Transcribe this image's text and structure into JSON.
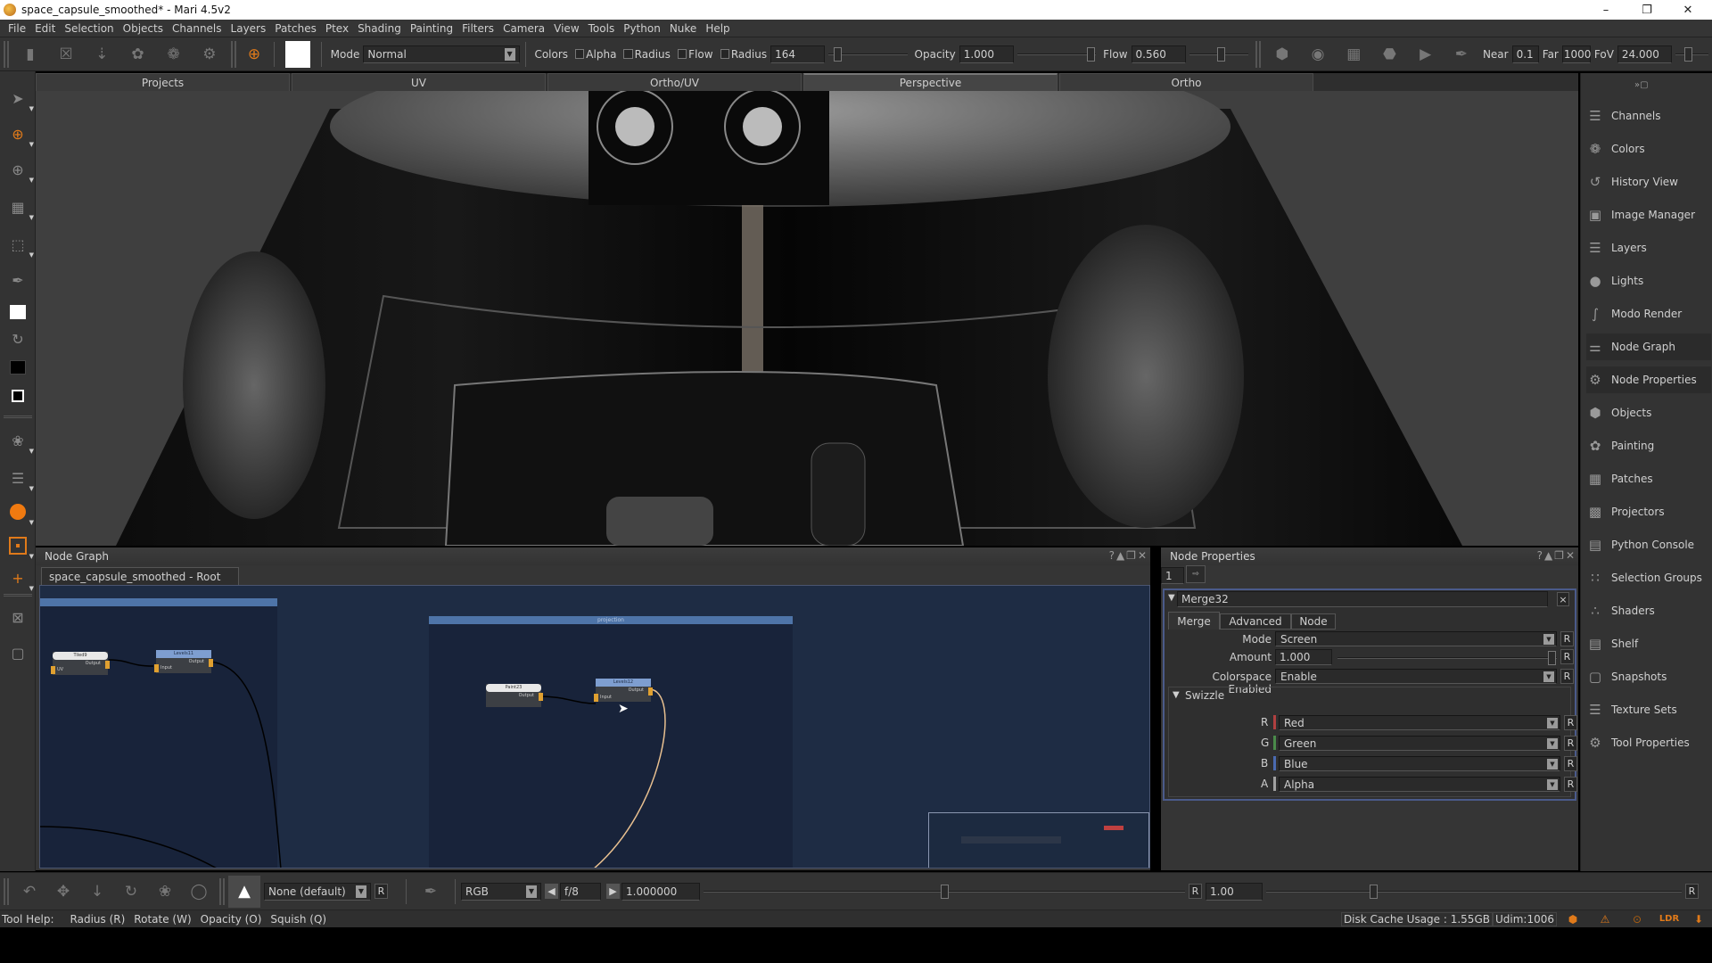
{
  "window": {
    "title": "space_capsule_smoothed* - Mari 4.5v2",
    "controls": [
      "minimize",
      "restore",
      "close"
    ]
  },
  "menubar": {
    "items": [
      "File",
      "Edit",
      "Selection",
      "Objects",
      "Channels",
      "Layers",
      "Patches",
      "Ptex",
      "Shading",
      "Painting",
      "Filters",
      "Camera",
      "View",
      "Tools",
      "Python",
      "Nuke",
      "Help"
    ]
  },
  "toolbar": {
    "mode_label": "Mode",
    "mode_value": "Normal",
    "colors_label": "Colors",
    "alpha_label": "Alpha",
    "radius_chk_label": "Radius",
    "flow_chk_label": "Flow",
    "radius_label": "Radius",
    "radius_value": "164",
    "opacity_label": "Opacity",
    "opacity_value": "1.000",
    "opacity_fraction": 1.0,
    "flow_label": "Flow",
    "flow_value": "0.560",
    "flow_fraction": 0.56,
    "near_label": "Near",
    "near_value": "0.1",
    "far_label": "Far",
    "far_value": "1000",
    "fov_label": "FoV",
    "fov_value": "24.000",
    "icons": [
      "new-file-icon",
      "close-file-icon",
      "import-file-icon",
      "bake-icon",
      "bake-merge-icon",
      "file-settings-icon",
      "paint-through-icon",
      "color-swatch-white",
      "wireframe-cube-icon",
      "camera-snapshot-icon",
      "grid-select-icon",
      "flat-shade-icon",
      "screen-icon",
      "paint-brush-icon"
    ]
  },
  "view_tabs": [
    {
      "label": "Projects",
      "active": false
    },
    {
      "label": "UV",
      "active": false
    },
    {
      "label": "Ortho/UV",
      "active": false
    },
    {
      "label": "Perspective",
      "active": true
    },
    {
      "label": "Ortho",
      "active": false
    }
  ],
  "left_tools": [
    "select-icon",
    "paint-icon",
    "paint-through-icon",
    "patch-select-icon",
    "marquee-select-icon",
    "eyedropper-icon",
    "foreground-color-white",
    "swap-colors-icon",
    "background-color-black",
    "default-colors-icon",
    "transform-select-icon",
    "layer-visibility-icon",
    "orange-circle-icon",
    "projector-icon",
    "add-projector-icon",
    "hide-selection-icon",
    "isolate-icon"
  ],
  "right_panel": {
    "items": [
      {
        "label": "Channels",
        "icon": "channels-icon"
      },
      {
        "label": "Colors",
        "icon": "colors-icon"
      },
      {
        "label": "History View",
        "icon": "history-icon"
      },
      {
        "label": "Image Manager",
        "icon": "image-manager-icon"
      },
      {
        "label": "Layers",
        "icon": "layers-icon"
      },
      {
        "label": "Lights",
        "icon": "lights-icon"
      },
      {
        "label": "Modo Render",
        "icon": "modo-render-icon"
      },
      {
        "label": "Node Graph",
        "icon": "node-graph-icon",
        "selected": true
      },
      {
        "label": "Node Properties",
        "icon": "node-properties-icon",
        "selected": true
      },
      {
        "label": "Objects",
        "icon": "objects-icon"
      },
      {
        "label": "Painting",
        "icon": "painting-icon"
      },
      {
        "label": "Patches",
        "icon": "patches-icon"
      },
      {
        "label": "Projectors",
        "icon": "projectors-icon"
      },
      {
        "label": "Python Console",
        "icon": "python-console-icon"
      },
      {
        "label": "Selection Groups",
        "icon": "selection-groups-icon"
      },
      {
        "label": "Shaders",
        "icon": "shaders-icon"
      },
      {
        "label": "Shelf",
        "icon": "shelf-icon"
      },
      {
        "label": "Snapshots",
        "icon": "snapshots-icon"
      },
      {
        "label": "Texture Sets",
        "icon": "texture-sets-icon"
      },
      {
        "label": "Tool Properties",
        "icon": "tool-properties-icon"
      }
    ]
  },
  "node_graph": {
    "title": "Node Graph",
    "tab": "space_capsule_smoothed - Root",
    "backdrops": [
      {
        "label": ""
      },
      {
        "label": "projection"
      }
    ],
    "nodes": [
      {
        "name": "Tiled9",
        "header": "white",
        "ports_in": [
          "UV"
        ],
        "ports_out": [
          "Output"
        ]
      },
      {
        "name": "Levels11",
        "header": "blue",
        "ports_in": [
          "Input"
        ],
        "ports_out": [
          "Output"
        ]
      },
      {
        "name": "Paint23",
        "header": "white",
        "ports_in": [],
        "ports_out": [
          "Output"
        ]
      },
      {
        "name": "Levels12",
        "header": "blue",
        "ports_in": [
          "Input"
        ],
        "ports_out": [
          "Output"
        ]
      }
    ]
  },
  "node_properties": {
    "title": "Node Properties",
    "count_value": "1",
    "node_name": "Merge32",
    "tabs": [
      "Merge",
      "Advanced",
      "Node"
    ],
    "active_tab": "Merge",
    "mode_label": "Mode",
    "mode_value": "Screen",
    "amount_label": "Amount",
    "amount_value": "1.000",
    "amount_fraction": 1.0,
    "colorspace_label": "Colorspace Enabled",
    "colorspace_value": "Enable",
    "swizzle_label": "Swizzle",
    "swizzle": [
      {
        "channel": "R",
        "value": "Red",
        "color": "#b04040"
      },
      {
        "channel": "G",
        "value": "Green",
        "color": "#4a8a4a"
      },
      {
        "channel": "B",
        "value": "Blue",
        "color": "#4a6ab0"
      },
      {
        "channel": "A",
        "value": "Alpha",
        "color": "#a0a0a0"
      }
    ],
    "reset_label": "R"
  },
  "bottom_bar": {
    "shader_value": "None (default)",
    "reset_label": "R",
    "channel_value": "RGB",
    "fstop_value": "f/8",
    "exposure_value": "1.000000",
    "gamma_reset": "R",
    "gamma_value": "1.00"
  },
  "status_bar": {
    "tool_help": "Tool Help:",
    "hints": [
      "Radius (R)",
      "Rotate (W)",
      "Opacity (O)",
      "Squish (Q)"
    ],
    "disk_cache": "Disk Cache Usage : 1.55GB",
    "udim": "Udim:1006",
    "lut_label": "LDR"
  },
  "colors": {
    "accent_orange": "#e07a1a",
    "panel_bg": "#353535",
    "graph_bg": "#1e2c44",
    "backdrop_bar": "#4e74a8"
  }
}
